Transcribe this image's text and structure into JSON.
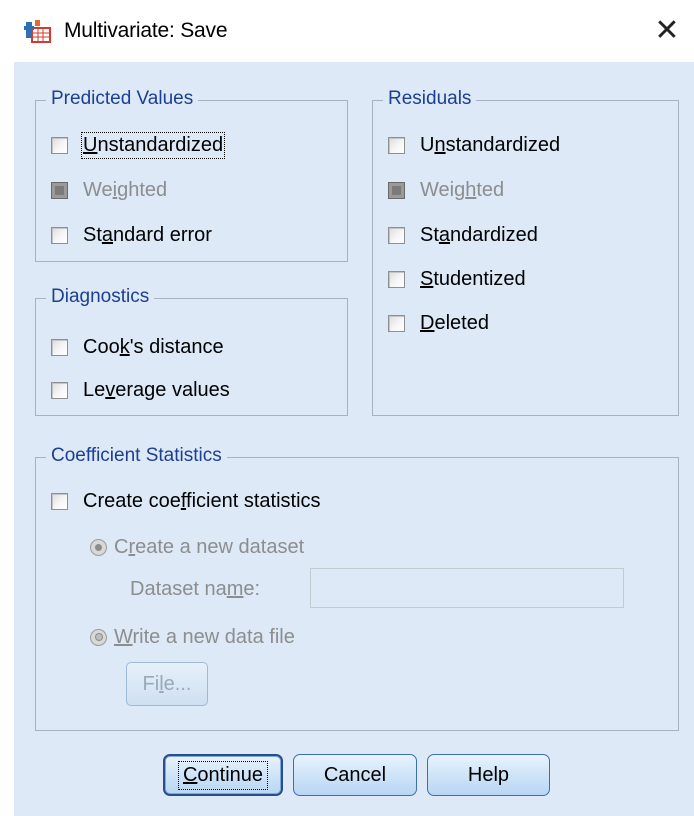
{
  "window": {
    "title": "Multivariate: Save",
    "close_icon": "close-icon"
  },
  "predicted_values": {
    "legend": "Predicted Values",
    "unstandardized": {
      "pre": "",
      "key": "U",
      "post": "nstandardized",
      "checked": false
    },
    "weighted": {
      "pre": "We",
      "key": "i",
      "post": "ghted",
      "disabled": true
    },
    "standard_error": {
      "pre": "St",
      "key": "a",
      "post": "ndard error",
      "checked": false
    }
  },
  "diagnostics": {
    "legend": "Diagnostics",
    "cooks": {
      "pre": "Coo",
      "key": "k",
      "post": "'s distance",
      "checked": false
    },
    "leverage": {
      "pre": "Le",
      "key": "v",
      "post": "erage values",
      "checked": false
    }
  },
  "residuals": {
    "legend": "Residuals",
    "unstandardized": {
      "pre": "U",
      "key": "n",
      "post": "standardized",
      "checked": false
    },
    "weighted": {
      "pre": "Weig",
      "key": "h",
      "post": "ted",
      "disabled": true
    },
    "standardized": {
      "pre": "St",
      "key": "a",
      "post": "ndardized",
      "checked": false
    },
    "studentized": {
      "pre": "",
      "key": "S",
      "post": "tudentized",
      "checked": false
    },
    "deleted": {
      "pre": "",
      "key": "D",
      "post": "eleted",
      "checked": false
    }
  },
  "coefficient": {
    "legend": "Coefficient Statistics",
    "create": {
      "pre": "Create coe",
      "key": "f",
      "post": "ficient statistics",
      "checked": false
    },
    "new_dataset": {
      "pre": "C",
      "key": "r",
      "post": "eate a new dataset",
      "selected": true,
      "disabled": true
    },
    "dataset_name": {
      "pre": "Dataset na",
      "key": "m",
      "post": "e:"
    },
    "dataset_value": "",
    "write_file": {
      "pre": "",
      "key": "W",
      "post": "rite a new data file",
      "selected": false,
      "disabled": true
    },
    "file_button": {
      "pre": "Fi",
      "key": "l",
      "post": "e..."
    }
  },
  "buttons": {
    "continue": {
      "pre": "",
      "key": "C",
      "post": "ontinue"
    },
    "cancel": "Cancel",
    "help": "Help"
  }
}
